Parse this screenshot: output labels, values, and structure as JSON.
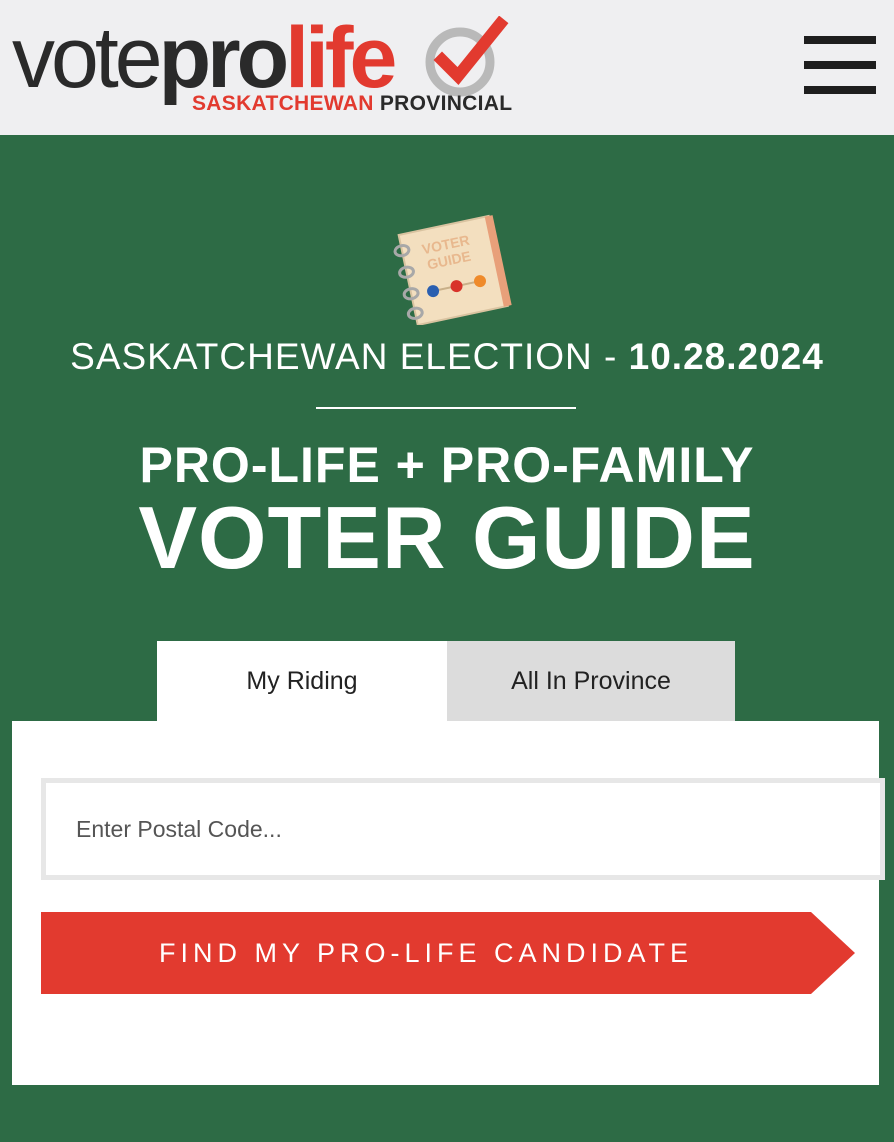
{
  "header": {
    "logo": {
      "vote": "vote",
      "pro": "pro",
      "life": "life",
      "subtitle_red": "SASKATCHEWAN",
      "subtitle_dark": "PROVINCIAL"
    },
    "menu_icon": "hamburger-menu-icon"
  },
  "hero": {
    "icon": "voter-guide-notebook-icon",
    "icon_text_line1": "VOTER",
    "icon_text_line2": "GUIDE",
    "election_label": "SASKATCHEWAN ELECTION - ",
    "election_date": "10.28.2024",
    "headline_line1": "PRO-LIFE + PRO-FAMILY",
    "headline_line2": "VOTER GUIDE"
  },
  "tabs": [
    {
      "label": "My Riding",
      "active": true
    },
    {
      "label": "All In Province",
      "active": false
    }
  ],
  "search": {
    "placeholder": "Enter Postal Code...",
    "value": "",
    "button_label": "FIND MY PRO-LIFE CANDIDATE"
  },
  "colors": {
    "background_green": "#2d6b45",
    "accent_red": "#e23a2f",
    "header_bg": "#efeff1",
    "inactive_tab": "#dcdcdc"
  }
}
